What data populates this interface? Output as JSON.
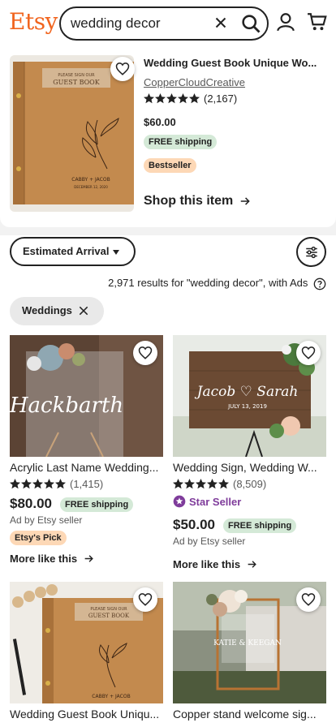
{
  "header": {
    "logo": "Etsy",
    "search_value": "wedding decor"
  },
  "featured": {
    "title": "Wedding Guest Book Unique Wo...",
    "shop": "CopperCloudCreative",
    "rating_count": "(2,167)",
    "price": "$60.00",
    "shipping": "FREE shipping",
    "badge": "Bestseller",
    "cta": "Shop this item",
    "image": {
      "plate": "PLEASE SIGN OUR",
      "plate2": "GUEST BOOK",
      "names": "CABBY + JACOB",
      "date": "DECEMBER 12, 2020"
    }
  },
  "controls": {
    "sort_label": "Estimated Arrival",
    "results_text": "2,971 results for \"wedding decor\", with Ads",
    "chip_label": "Weddings"
  },
  "listings": [
    {
      "title": "Acrylic Last Name Wedding...",
      "rating_count": "(1,415)",
      "price": "$80.00",
      "shipping": "FREE shipping",
      "ad_by": "Ad by Etsy seller",
      "badge": "Etsy's Pick",
      "more": "More like this",
      "image_text": "Hackbarth"
    },
    {
      "title": "Wedding Sign, Wedding W...",
      "rating_count": "(8,509)",
      "star_seller": "Star Seller",
      "price": "$50.00",
      "shipping": "FREE shipping",
      "ad_by": "Ad by Etsy seller",
      "more": "More like this",
      "image_text": "Jacob ♡ Sarah",
      "image_date": "JULY 13, 2019"
    },
    {
      "title": "Wedding Guest Book Uniqu...",
      "image_plate": "PLEASE SIGN OUR",
      "image_plate2": "GUEST BOOK",
      "image_names": "CABBY + JACOB"
    },
    {
      "title": "Copper stand welcome sig...",
      "image_text": "KATIE & KEEGAN"
    }
  ],
  "colors": {
    "brand": "#f1641e",
    "shipping_bg": "#d4e9d7",
    "bestseller_bg": "#fdd8b6",
    "star_seller": "#7f3c9b"
  }
}
